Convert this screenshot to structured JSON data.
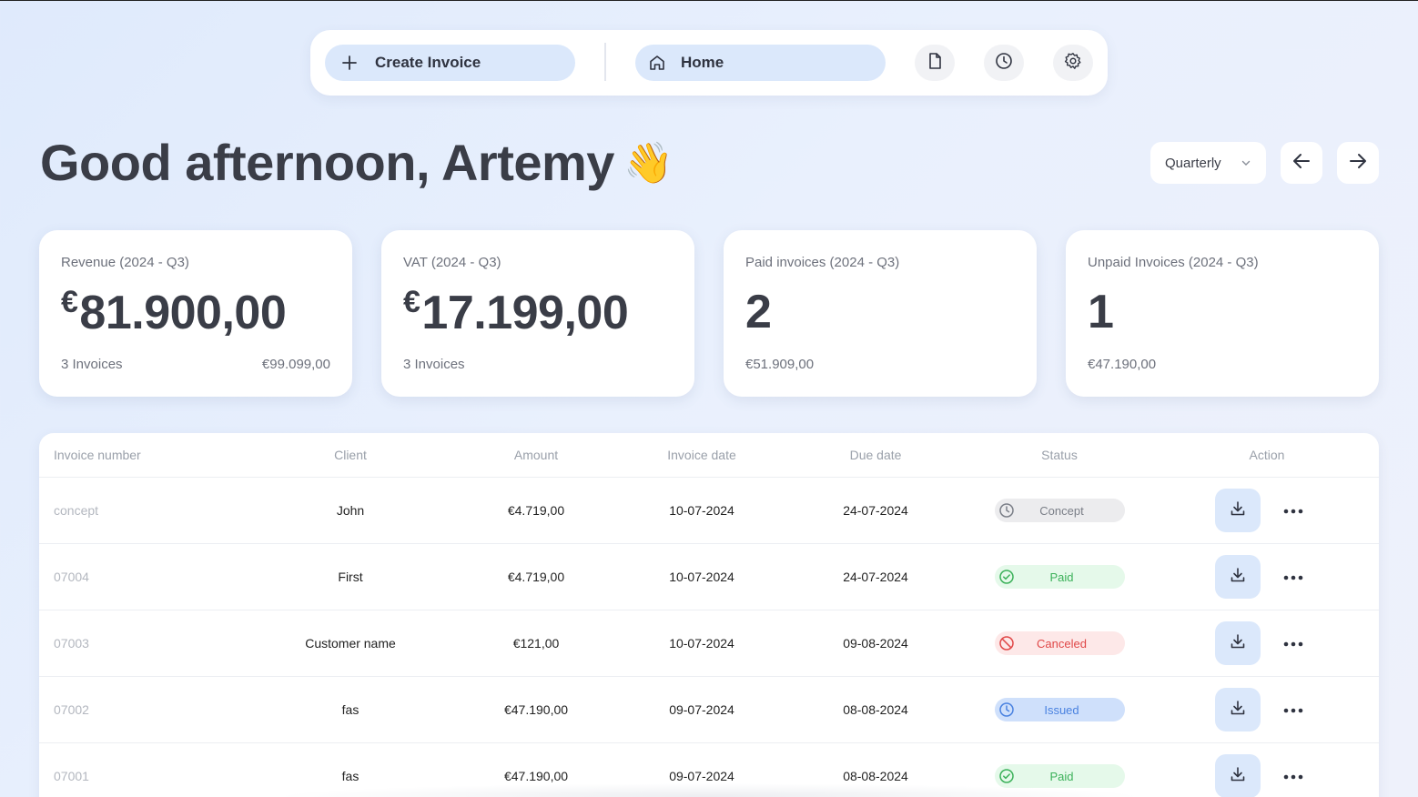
{
  "nav": {
    "create_label": "Create Invoice",
    "home_label": "Home"
  },
  "header": {
    "greeting": "Good afternoon, Artemy",
    "emoji": "👋",
    "period": "Quarterly"
  },
  "cards": [
    {
      "label": "Revenue (2024 - Q3)",
      "currency": "€",
      "value": "81.900,00",
      "sub": "3 Invoices",
      "sub2": "€99.099,00"
    },
    {
      "label": "VAT (2024 - Q3)",
      "currency": "€",
      "value": "17.199,00",
      "sub": "3 Invoices",
      "sub2": ""
    },
    {
      "label": "Paid invoices (2024 - Q3)",
      "currency": "",
      "value": "2",
      "sub": "€51.909,00",
      "sub2": ""
    },
    {
      "label": "Unpaid Invoices (2024 - Q3)",
      "currency": "",
      "value": "1",
      "sub": "€47.190,00",
      "sub2": ""
    }
  ],
  "table": {
    "columns": [
      "Invoice number",
      "Client",
      "Amount",
      "Invoice date",
      "Due date",
      "Status",
      "Action"
    ],
    "rows": [
      {
        "number": "concept",
        "client": "John",
        "amount": "€4.719,00",
        "invoice_date": "10-07-2024",
        "due_date": "24-07-2024",
        "status": "Concept"
      },
      {
        "number": "07004",
        "client": "First",
        "amount": "€4.719,00",
        "invoice_date": "10-07-2024",
        "due_date": "24-07-2024",
        "status": "Paid"
      },
      {
        "number": "07003",
        "client": "Customer name",
        "amount": "€121,00",
        "invoice_date": "10-07-2024",
        "due_date": "09-08-2024",
        "status": "Canceled"
      },
      {
        "number": "07002",
        "client": "fas",
        "amount": "€47.190,00",
        "invoice_date": "09-07-2024",
        "due_date": "08-08-2024",
        "status": "Issued"
      },
      {
        "number": "07001",
        "client": "fas",
        "amount": "€47.190,00",
        "invoice_date": "09-07-2024",
        "due_date": "08-08-2024",
        "status": "Paid"
      }
    ]
  },
  "colors": {
    "accent_bg": "#dbe8fb",
    "paid": "#3cb15a",
    "canceled": "#e04848",
    "issued": "#4a82e0",
    "concept": "#7b7f88"
  }
}
